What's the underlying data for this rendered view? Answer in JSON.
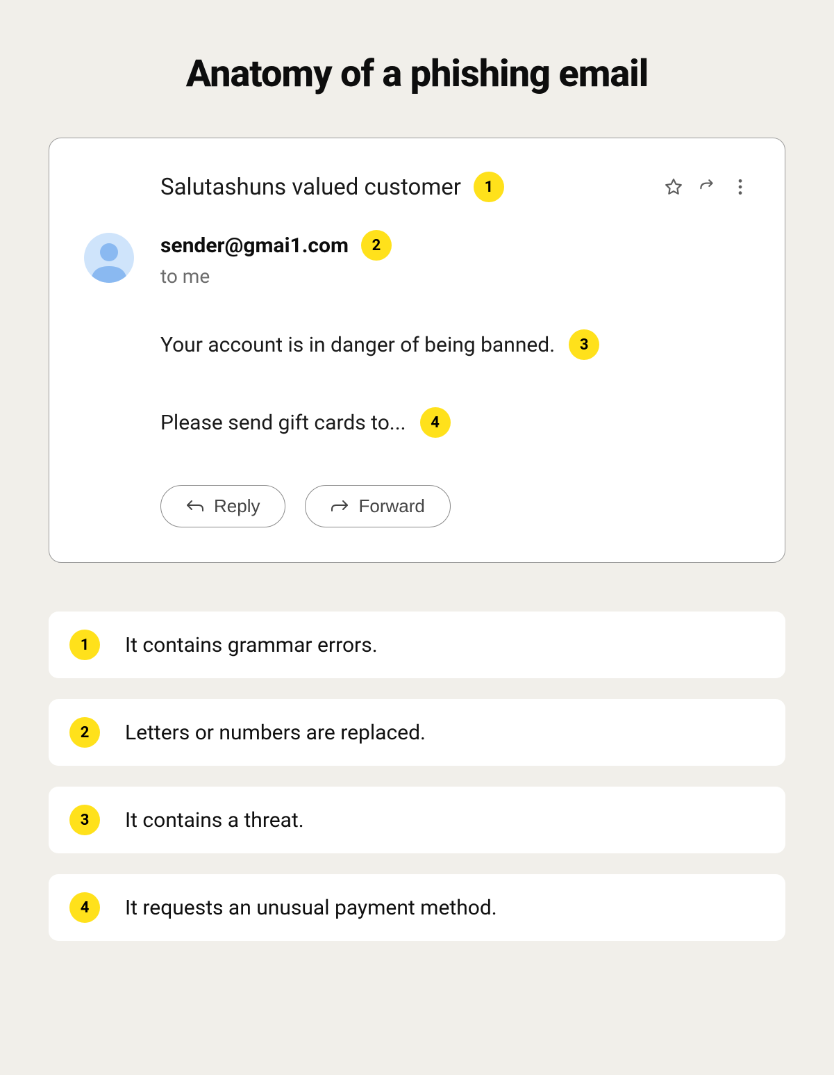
{
  "title": "Anatomy of a phishing email",
  "email": {
    "subject": "Salutashuns valued customer",
    "sender": "sender@gmai1.com",
    "recipient": "to me",
    "body_line_1": "Your account is in danger of being banned.",
    "body_line_2": "Please send gift cards to...",
    "reply_label": "Reply",
    "forward_label": "Forward",
    "badges": {
      "subject": "1",
      "sender": "2",
      "body1": "3",
      "body2": "4"
    }
  },
  "legend": [
    {
      "num": "1",
      "text": "It contains grammar errors."
    },
    {
      "num": "2",
      "text": "Letters or numbers are replaced."
    },
    {
      "num": "3",
      "text": "It contains a threat."
    },
    {
      "num": "4",
      "text": "It requests an unusual payment method."
    }
  ]
}
